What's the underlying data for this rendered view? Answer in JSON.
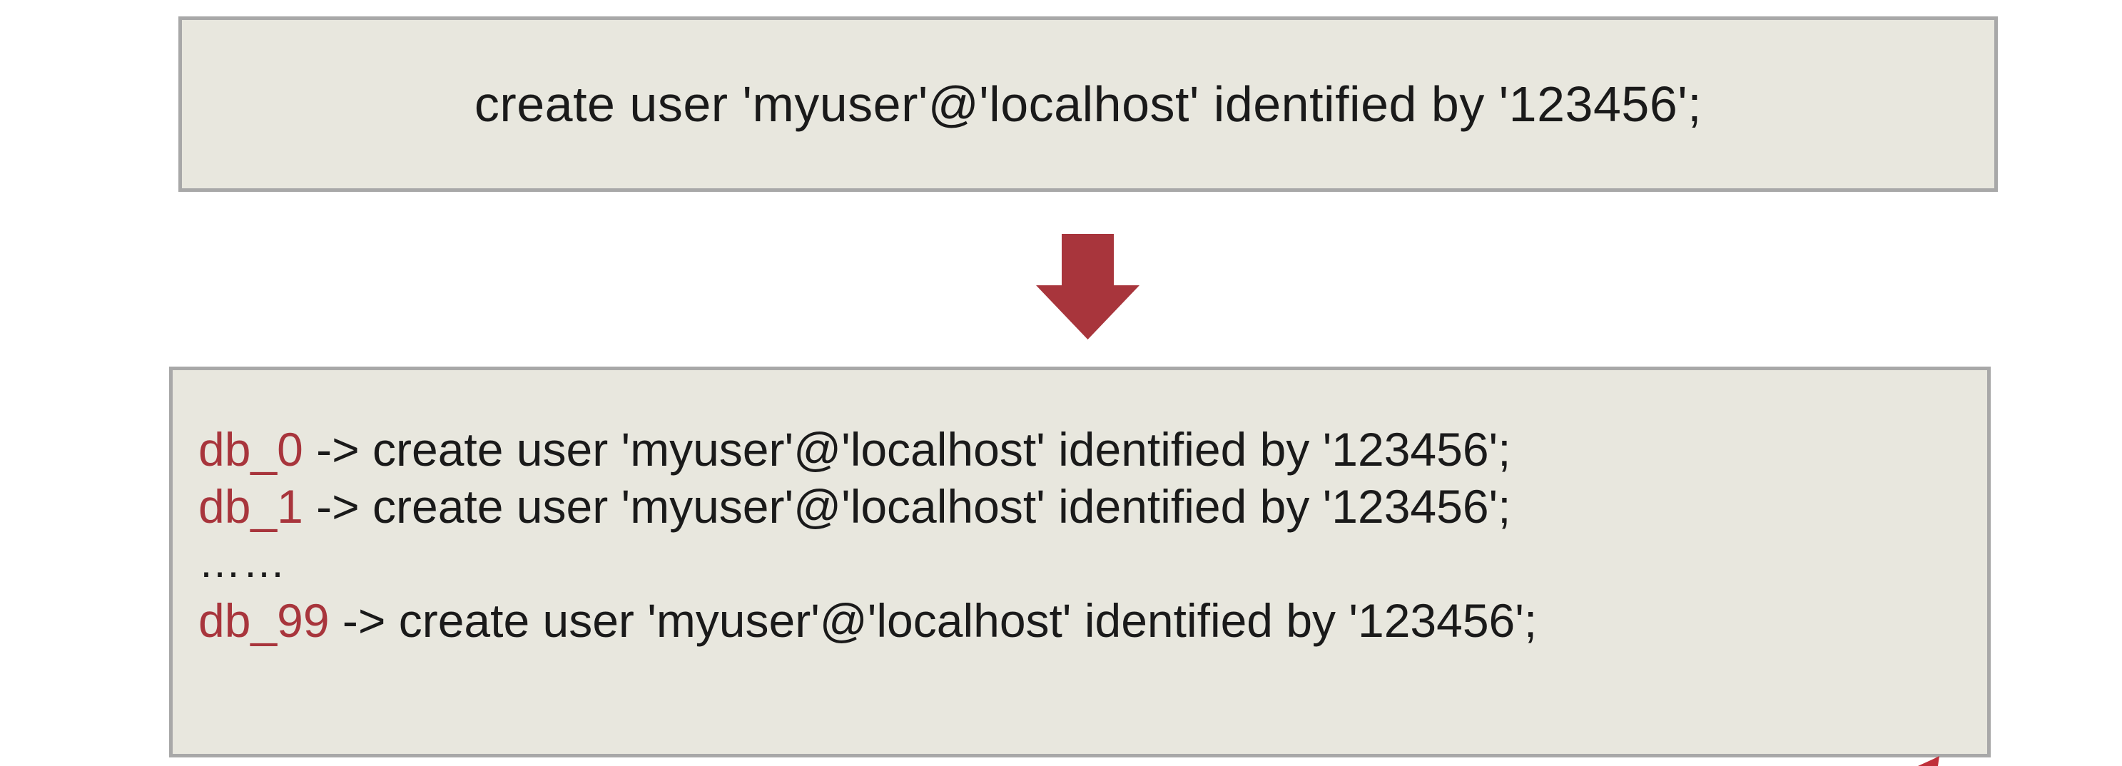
{
  "top_statement": "create user 'myuser'@'localhost' identified by '123456';",
  "flow_arrow": {
    "icon": "arrow-down-icon",
    "color": "#a8353c"
  },
  "bottom_lines": [
    {
      "db": "db_0",
      "rest": " -> create user 'myuser'@'localhost' identified by '123456';"
    },
    {
      "db": "db_1",
      "rest": " -> create user 'myuser'@'localhost' identified by '123456';"
    },
    {
      "ellipsis": "……"
    },
    {
      "db": "db_99",
      "rest": " -> create user 'myuser'@'localhost' identified by '123456';"
    }
  ],
  "colors": {
    "box_fill": "#e8e7de",
    "box_border": "#a8a8a8",
    "db_label": "#a8353c",
    "text": "#1a1a1a"
  }
}
